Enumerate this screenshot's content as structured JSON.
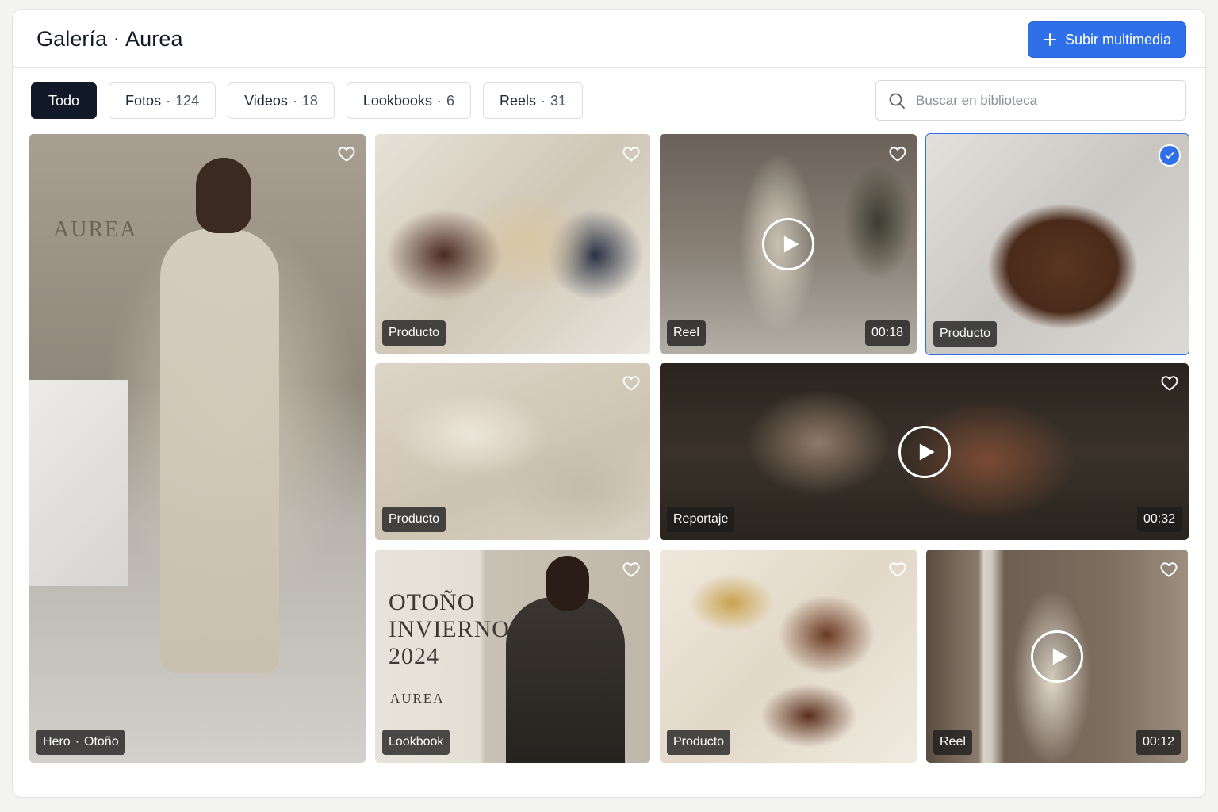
{
  "header": {
    "title": "Galería",
    "subtitle": "Aurea",
    "upload_label": "Subir multimedia"
  },
  "filters": [
    {
      "label": "Todo",
      "count": "",
      "active": true
    },
    {
      "label": "Fotos",
      "count": "124",
      "active": false
    },
    {
      "label": "Videos",
      "count": "18",
      "active": false
    },
    {
      "label": "Lookbooks",
      "count": "6",
      "active": false
    },
    {
      "label": "Reels",
      "count": "31",
      "active": false
    }
  ],
  "search": {
    "placeholder": "Buscar en biblioteca",
    "value": ""
  },
  "colors": {
    "accent": "#2f6fe8",
    "active_chip": "#111827",
    "tag_bg": "#1c1c1c"
  },
  "media": [
    {
      "label": "Hero",
      "label2": "Otoño",
      "type": "photo",
      "duration": "",
      "wall_text": "AUREA",
      "selected": false
    },
    {
      "label": "Producto",
      "type": "photo",
      "duration": "",
      "selected": false
    },
    {
      "label": "Reel",
      "type": "video",
      "duration": "00:18",
      "selected": false
    },
    {
      "label": "Producto",
      "type": "photo",
      "duration": "",
      "selected": true
    },
    {
      "label": "Producto",
      "type": "photo",
      "duration": "",
      "selected": false
    },
    {
      "label": "Reportaje",
      "type": "video",
      "duration": "00:32",
      "selected": false
    },
    {
      "label": "Lookbook",
      "type": "photo",
      "duration": "",
      "overlay_lines": [
        "OTOÑO",
        "INVIERNO",
        "2024"
      ],
      "overlay_brand": "AUREA",
      "selected": false
    },
    {
      "label": "Producto",
      "type": "photo",
      "duration": "",
      "selected": false
    },
    {
      "label": "Reel",
      "type": "video",
      "duration": "00:12",
      "selected": false
    }
  ]
}
